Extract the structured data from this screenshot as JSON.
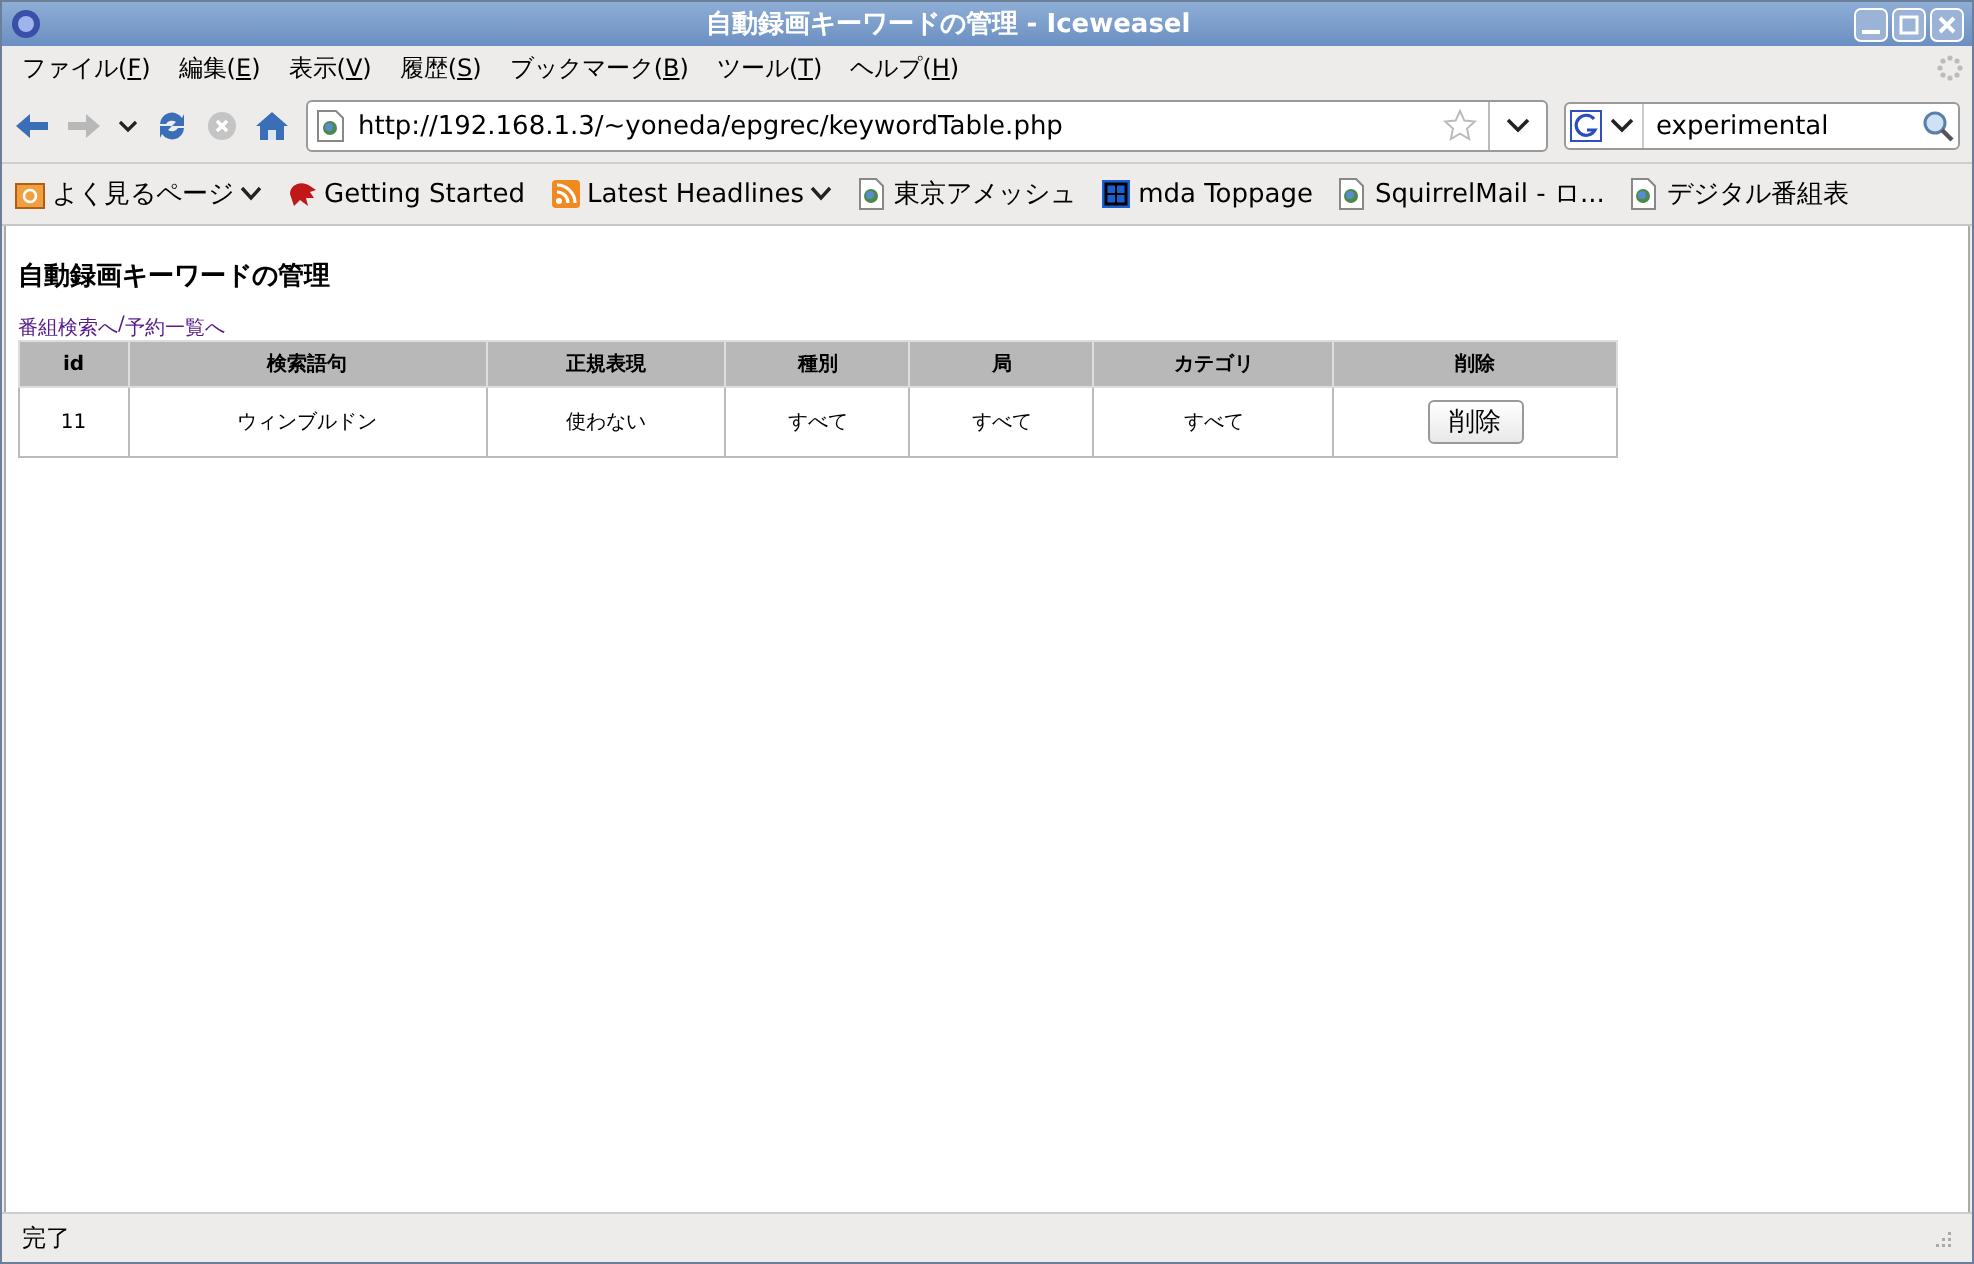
{
  "window": {
    "title": "自動録画キーワードの管理 - Iceweasel"
  },
  "menu": [
    {
      "before": "ファイル(",
      "key": "F",
      "after": ")"
    },
    {
      "before": "編集(",
      "key": "E",
      "after": ")"
    },
    {
      "before": "表示(",
      "key": "V",
      "after": ")"
    },
    {
      "before": "履歴(",
      "key": "S",
      "after": ")"
    },
    {
      "before": "ブックマーク(",
      "key": "B",
      "after": ")"
    },
    {
      "before": "ツール(",
      "key": "T",
      "after": ")"
    },
    {
      "before": "ヘルプ(",
      "key": "H",
      "after": ")"
    }
  ],
  "navigation": {
    "back_disabled": false,
    "forward_disabled": true,
    "stop_disabled": true,
    "url": "http://192.168.1.3/~yoneda/epgrec/keywordTable.php",
    "search_value": "experimental"
  },
  "bookmarks": [
    {
      "label": "よく見るページ",
      "kind": "folder",
      "dropdown": true
    },
    {
      "label": "Getting Started",
      "kind": "dragon",
      "dropdown": false
    },
    {
      "label": "Latest Headlines",
      "kind": "rss",
      "dropdown": true
    },
    {
      "label": "東京アメッシュ",
      "kind": "page",
      "dropdown": false
    },
    {
      "label": "mda Toppage",
      "kind": "grid",
      "dropdown": false
    },
    {
      "label": "SquirrelMail - ロ...",
      "kind": "page",
      "dropdown": false
    },
    {
      "label": "デジタル番組表",
      "kind": "page",
      "dropdown": false
    }
  ],
  "page": {
    "heading": "自動録画キーワードの管理",
    "links": [
      {
        "label": "番組検索へ"
      },
      {
        "label": "予約一覧へ"
      }
    ],
    "link_separator": "/",
    "table": {
      "columns": [
        "id",
        "検索語句",
        "正規表現",
        "種別",
        "局",
        "カテゴリ",
        "削除"
      ],
      "rows": [
        [
          {
            "kind": "text",
            "value": "11"
          },
          {
            "kind": "text",
            "value": "ウィンブルドン"
          },
          {
            "kind": "text",
            "value": "使わない"
          },
          {
            "kind": "text",
            "value": "すべて"
          },
          {
            "kind": "text",
            "value": "すべて"
          },
          {
            "kind": "text",
            "value": "すべて"
          },
          {
            "kind": "button",
            "value": "削除"
          }
        ]
      ]
    }
  },
  "status_bar": {
    "text": "完了"
  }
}
